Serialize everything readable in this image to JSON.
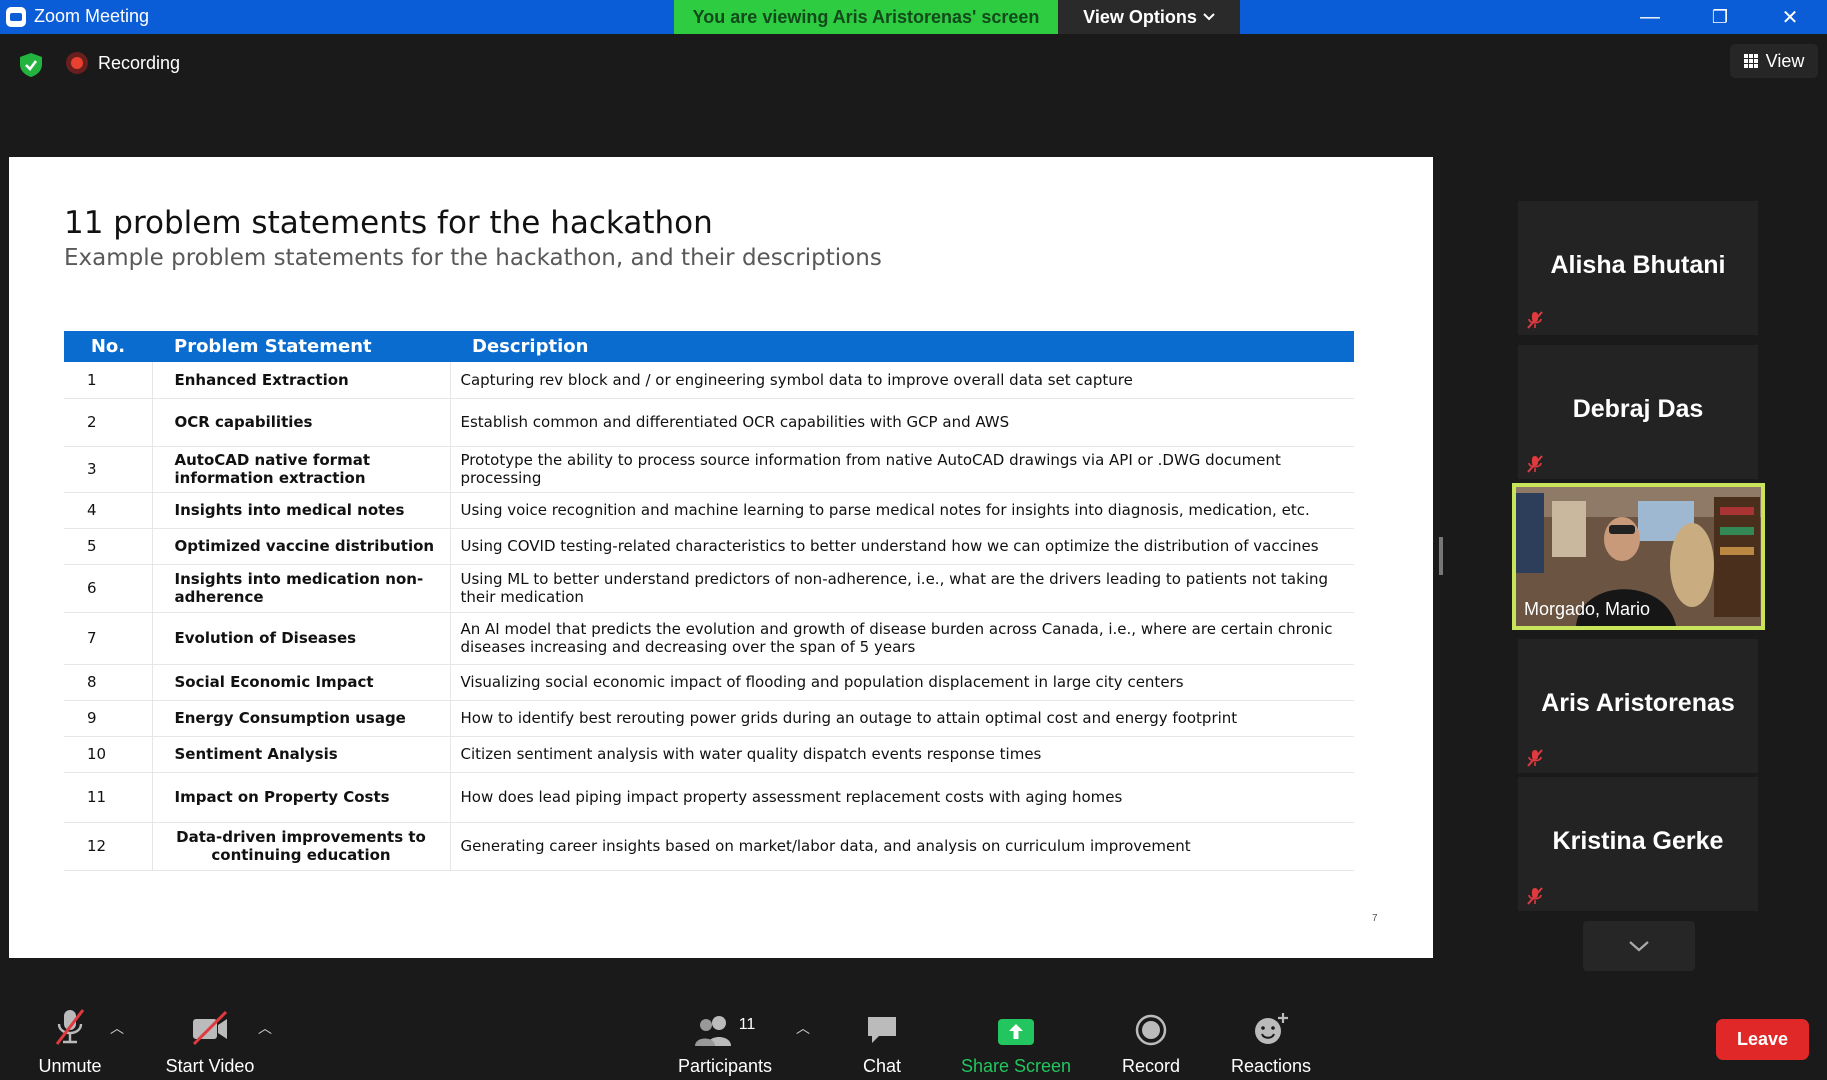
{
  "titlebar": {
    "app_title": "Zoom Meeting",
    "viewing_banner": "You are viewing Aris Aristorenas' screen",
    "view_options_label": "View Options",
    "minimize_glyph": "—",
    "restore_glyph": "❐",
    "close_glyph": "✕"
  },
  "meeting_bar": {
    "recording_label": "Recording",
    "view_label": "View"
  },
  "slide": {
    "title": "11 problem statements for the hackathon",
    "subtitle": "Example problem statements for the hackathon, and their descriptions",
    "page_number": "7",
    "columns": [
      "No.",
      "Problem Statement",
      "Description"
    ],
    "rows": [
      {
        "no": "1",
        "statement": "Enhanced Extraction",
        "description": "Capturing rev block and / or engineering symbol data to improve overall data set capture"
      },
      {
        "no": "2",
        "statement": "OCR capabilities",
        "description": "Establish common and differentiated OCR capabilities with GCP and AWS"
      },
      {
        "no": "3",
        "statement": "AutoCAD native format information extraction",
        "description": "Prototype the ability to process source information from native AutoCAD drawings via API or .DWG document processing"
      },
      {
        "no": "4",
        "statement": "Insights into medical notes",
        "description": "Using voice recognition and machine learning to parse medical notes for insights into diagnosis, medication, etc."
      },
      {
        "no": "5",
        "statement": "Optimized vaccine distribution",
        "description": "Using COVID testing-related characteristics to better understand how we can optimize the distribution of vaccines"
      },
      {
        "no": "6",
        "statement": "Insights into medication non-adherence",
        "description": "Using ML to better understand predictors of non-adherence, i.e., what are the drivers leading to patients not taking their medication"
      },
      {
        "no": "7",
        "statement": "Evolution of Diseases",
        "description": "An AI model that predicts the evolution and growth of disease burden across Canada, i.e., where are certain chronic diseases increasing and decreasing over the span of 5 years"
      },
      {
        "no": "8",
        "statement": "Social Economic Impact",
        "description": "Visualizing social economic impact of flooding and population displacement in large city centers"
      },
      {
        "no": "9",
        "statement": "Energy Consumption usage",
        "description": "How to identify best rerouting power grids during an outage to attain optimal cost and energy footprint"
      },
      {
        "no": "10",
        "statement": "Sentiment Analysis",
        "description": "Citizen sentiment analysis with water quality dispatch events response times"
      },
      {
        "no": "11",
        "statement": "Impact on Property Costs",
        "description": "How does lead piping impact property assessment replacement costs with aging homes"
      },
      {
        "no": "12",
        "statement": "Data-driven improvements to continuing education",
        "description": "Generating career insights based on market/labor data, and analysis on curriculum improvement"
      }
    ]
  },
  "participants": [
    {
      "name": "Alisha Bhutani",
      "muted": true
    },
    {
      "name": "Debraj Das",
      "muted": true
    },
    {
      "name": "Morgado, Mario",
      "video": true
    },
    {
      "name": "Aris Aristorenas",
      "muted": true
    },
    {
      "name": "Kristina Gerke",
      "muted": true
    }
  ],
  "toolbar": {
    "unmute": "Unmute",
    "start_video": "Start Video",
    "participants": "Participants",
    "participants_count": "11",
    "chat": "Chat",
    "share_screen": "Share Screen",
    "record": "Record",
    "reactions": "Reactions",
    "leave": "Leave"
  },
  "colors": {
    "titlebar": "#0b5cd7",
    "viewing_banner": "#2ecc40",
    "table_header": "#0b6cd0",
    "share_screen_green": "#22c55e",
    "leave_red": "#e02828",
    "active_speaker_border": "#c8e45a",
    "muted_red": "#e0393e"
  }
}
